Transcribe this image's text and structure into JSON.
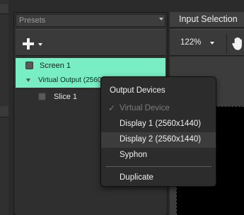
{
  "presets_panel": {
    "dropdown_label": "Presets",
    "tree": {
      "screen": {
        "label": "Screen 1"
      },
      "virtual_output": {
        "label": "Virtual Output (2560x"
      },
      "slice": {
        "label": "Slice 1"
      }
    }
  },
  "input_selection": {
    "tab_label": "Input Selection",
    "zoom_value": "122%"
  },
  "context_menu": {
    "header": "Output Devices",
    "items": [
      {
        "label": "Virtual Device",
        "checked": true,
        "enabled": false
      },
      {
        "label": "Display 1 (2560x1440)"
      },
      {
        "label": "Display 2 (2560x1440)"
      },
      {
        "label": "Syphon"
      },
      {
        "label": "Duplicate"
      }
    ]
  },
  "colors": {
    "selection_highlight": "#79edc4",
    "panel_bg": "#2e2e2e",
    "menu_bg": "#2c2c2c"
  }
}
